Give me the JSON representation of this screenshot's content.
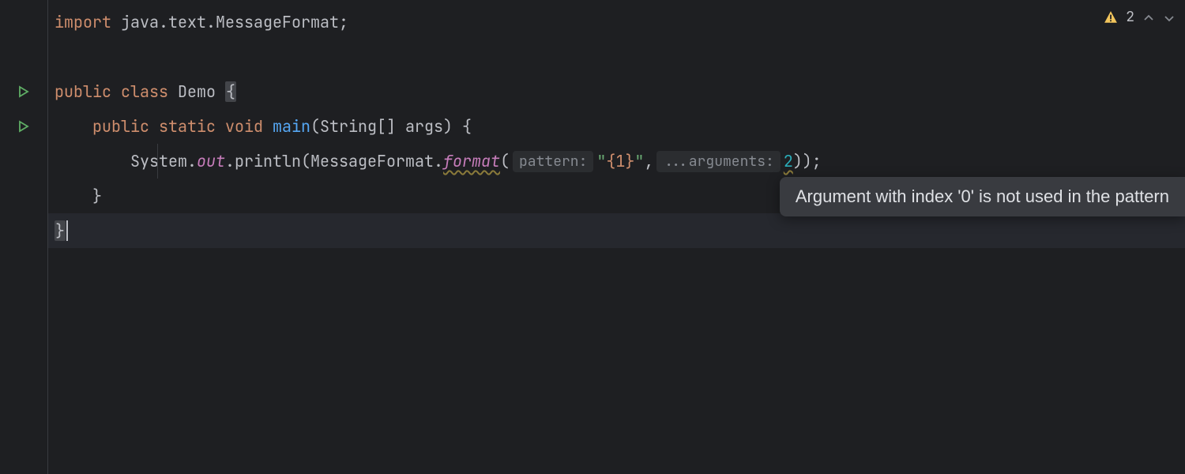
{
  "inspection": {
    "warning_count": "2"
  },
  "tooltip": {
    "text": "Argument with index '0' is not used in the pattern"
  },
  "code": {
    "line1": {
      "import_kw": "import",
      "import_pkg": " java.text.MessageFormat;"
    },
    "line3": {
      "public_kw": "public",
      "class_kw": "class",
      "name": "Demo",
      "brace": "{"
    },
    "line4": {
      "indent": "    ",
      "public_kw": "public",
      "static_kw": "static",
      "void_kw": "void",
      "main": "main",
      "params_open": "(",
      "param_type": "String[] args",
      "params_close": ")",
      "brace": " {"
    },
    "line5": {
      "indent": "        ",
      "system": "System.",
      "out": "out",
      "println": ".println(",
      "msgfmt": "MessageFormat.",
      "format": "format",
      "open": "(",
      "hint1": "pattern:",
      "str_open": "\"",
      "str_ph": "{1}",
      "str_close": "\"",
      "comma": ",",
      "hint2": "...arguments:",
      "num": "2",
      "close": "));"
    },
    "line6": {
      "indent": "    ",
      "brace": "}"
    },
    "line7": {
      "brace": "}"
    }
  }
}
